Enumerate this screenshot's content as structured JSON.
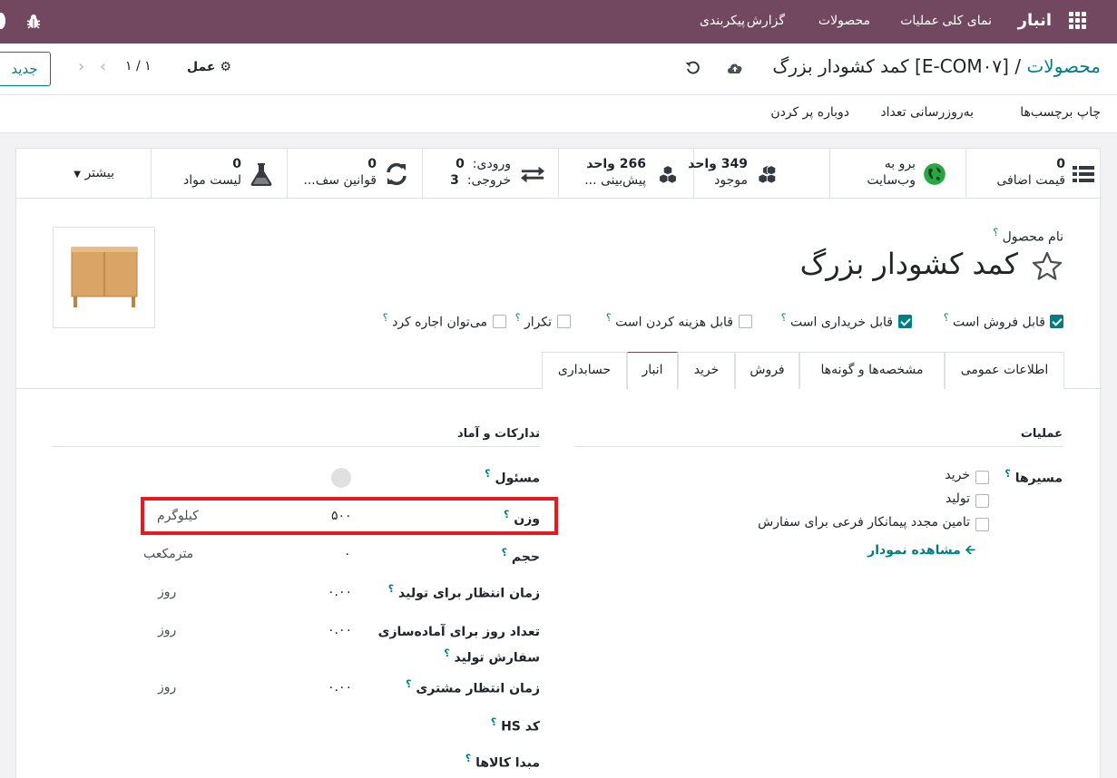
{
  "navbar": {
    "brand": "انبار",
    "menu": [
      "نمای کلی",
      "عملیات",
      "محصولات",
      "گزارش",
      "پیکربندی"
    ]
  },
  "control": {
    "breadcrumb_parent": "محصولات",
    "breadcrumb_sep": "/",
    "breadcrumb_current": "[E-COM۰۷] کمد کشودار بزرگ",
    "action_label": "عمل",
    "pager": "۱ / ۱",
    "new_button": "جدید"
  },
  "actionbar": {
    "items": [
      "چاپ برچسب‌ها",
      "به‌روزرسانی تعداد",
      "دوباره پر کردن"
    ]
  },
  "smart_buttons": {
    "extra_price": {
      "value": "0",
      "label": "قیمت اضافی"
    },
    "website": {
      "line1": "برو به",
      "line2": "وب‌سایت"
    },
    "on_hand": {
      "value": "349 واحد",
      "label": "موجود"
    },
    "forecast": {
      "value": "266 واحد",
      "label": "پیش‌بینی ..."
    },
    "in_out": {
      "in_label": "ورودی:",
      "in_value": "0",
      "out_label": "خروجی:",
      "out_value": "3"
    },
    "rules": {
      "value": "0",
      "label": "قوانین سف..."
    },
    "bom": {
      "value": "0",
      "label": "لیست مواد"
    },
    "more": "بیشتر"
  },
  "product": {
    "name_label": "نام محصول",
    "help": "؟",
    "name": "کمد کشودار بزرگ"
  },
  "flags": [
    {
      "label": "قابل فروش است",
      "checked": true
    },
    {
      "label": "قابل خریداری است",
      "checked": true
    },
    {
      "label": "قابل هزینه کردن است",
      "checked": false
    },
    {
      "label": "تکرار",
      "checked": false
    },
    {
      "label": "می‌توان اجاره کرد",
      "checked": false
    }
  ],
  "tabs": [
    "اطلاعات عمومی",
    "مشخصه‌ها و گونه‌ها",
    "فروش",
    "خرید",
    "انبار",
    "حسابداری"
  ],
  "active_tab": "انبار",
  "operations": {
    "title": "عملیات",
    "routes_label": "مسیرها",
    "routes": [
      "خرید",
      "تولید",
      "تامین مجدد پیمانکار فرعی برای سفارش"
    ],
    "diagram_link": "مشاهده نمودار"
  },
  "logistics": {
    "title": "تدارکات و آماد",
    "responsible_label": "مسئول",
    "weight_label": "وزن",
    "weight_value": "۵۰۰",
    "weight_unit": "کیلوگرم",
    "volume_label": "حجم",
    "volume_value": "۰",
    "volume_unit": "مترمکعب",
    "mfg_lead_label": "زمان انتظار برای تولید",
    "mfg_lead_value": "۰.۰۰",
    "mfg_lead_unit": "روز",
    "prep_days_label_1": "تعداد روز برای آماده‌سازی",
    "prep_days_label_2": "سفارش تولید",
    "prep_days_value": "۰.۰۰",
    "prep_days_unit": "روز",
    "customer_lead_label": "زمان انتظار مشتری",
    "customer_lead_value": "۰.۰۰",
    "customer_lead_unit": "روز",
    "hs_code_label": "کد HS",
    "origin_label": "مبدا کالاها"
  },
  "colors": {
    "navbar": "#71485f",
    "accent": "#017e84",
    "highlight": "#e51b22"
  }
}
